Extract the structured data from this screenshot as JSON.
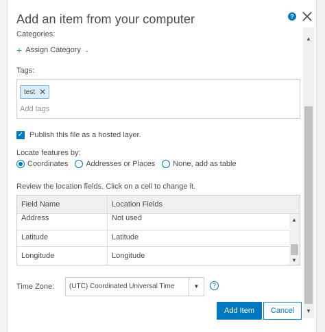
{
  "dialog": {
    "title": "Add an item from your computer",
    "help_icon": "question-circle-icon",
    "close_icon": "close-icon"
  },
  "categories": {
    "label": "Categories:",
    "assign_label": "Assign Category"
  },
  "tags": {
    "label": "Tags:",
    "items": [
      "test"
    ],
    "placeholder": "Add tags"
  },
  "publish": {
    "checked": true,
    "label": "Publish this file as a hosted layer."
  },
  "locate": {
    "label": "Locate features by:",
    "options": [
      {
        "label": "Coordinates",
        "selected": true
      },
      {
        "label": "Addresses or Places",
        "selected": false
      },
      {
        "label": "None, add as table",
        "selected": false
      }
    ]
  },
  "review": {
    "label": "Review the location fields. Click on a cell to change it.",
    "columns": [
      "Field Name",
      "Location Fields"
    ],
    "rows": [
      {
        "field": "Address",
        "location": "Not used"
      },
      {
        "field": "Latitude",
        "location": "Latitude"
      },
      {
        "field": "Longitude",
        "location": "Longitude"
      }
    ]
  },
  "timezone": {
    "label": "Time Zone:",
    "value": "(UTC) Coordinated Universal Time"
  },
  "buttons": {
    "add_item": "Add Item",
    "cancel": "Cancel"
  },
  "colors": {
    "accent": "#0079c1",
    "plus_green": "#35ac46",
    "text": "#4c4c4c"
  }
}
